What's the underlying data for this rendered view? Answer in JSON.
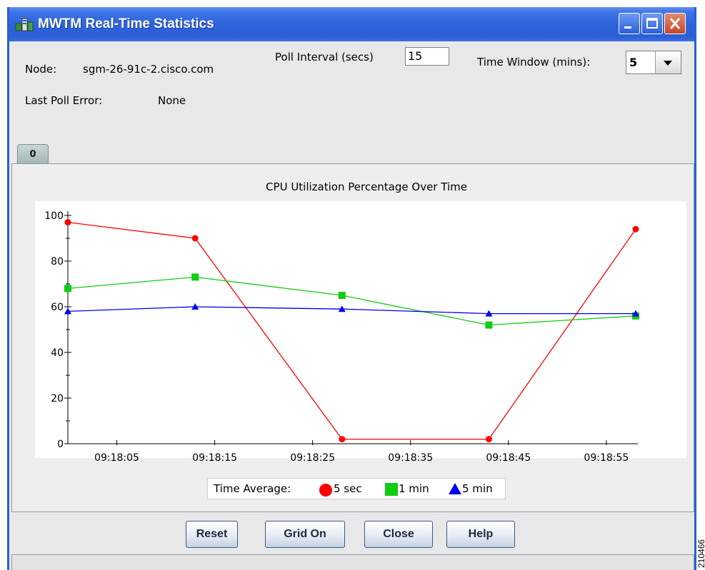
{
  "window": {
    "title": "MWTM Real-Time Statistics"
  },
  "header": {
    "node_label": "Node:",
    "node_value": "sgm-26-91c-2.cisco.com",
    "poll_label": "Poll Interval (secs)",
    "poll_value": "15",
    "window_label": "Time Window (mins):",
    "window_value": "5",
    "error_label": "Last Poll Error:",
    "error_value": "None"
  },
  "tabs": [
    {
      "label": "0"
    }
  ],
  "chart_data": {
    "type": "line",
    "title": "CPU Utilization Percentage Over Time",
    "xlabel": "",
    "ylabel": "",
    "ylim": [
      0,
      100
    ],
    "yticks": [
      "0",
      "20",
      "40",
      "60",
      "80",
      "100"
    ],
    "xtick_labels": [
      "09:18:05",
      "09:18:15",
      "09:18:25",
      "09:18:35",
      "09:18:45",
      "09:18:55"
    ],
    "x": [
      "09:18:00",
      "09:18:13",
      "09:18:28",
      "09:18:43",
      "09:18:58"
    ],
    "legend_title": "Time Average:",
    "series": [
      {
        "name": "5 sec",
        "color": "#ff0000",
        "marker": "circle",
        "values": [
          97,
          90,
          2,
          2,
          94
        ]
      },
      {
        "name": "1 min",
        "color": "#11cc11",
        "marker": "square",
        "values": [
          68,
          73,
          65,
          52,
          56
        ]
      },
      {
        "name": "5 min",
        "color": "#0000ee",
        "marker": "triangle",
        "values": [
          58,
          60,
          59,
          57,
          57
        ]
      }
    ],
    "grid": false
  },
  "buttons": {
    "reset": "Reset",
    "grid": "Grid On",
    "close": "Close",
    "help": "Help"
  },
  "figure_id": "210466",
  "colors": {
    "titlebar": "#2b5ed7",
    "close_button": "#c8432a"
  }
}
